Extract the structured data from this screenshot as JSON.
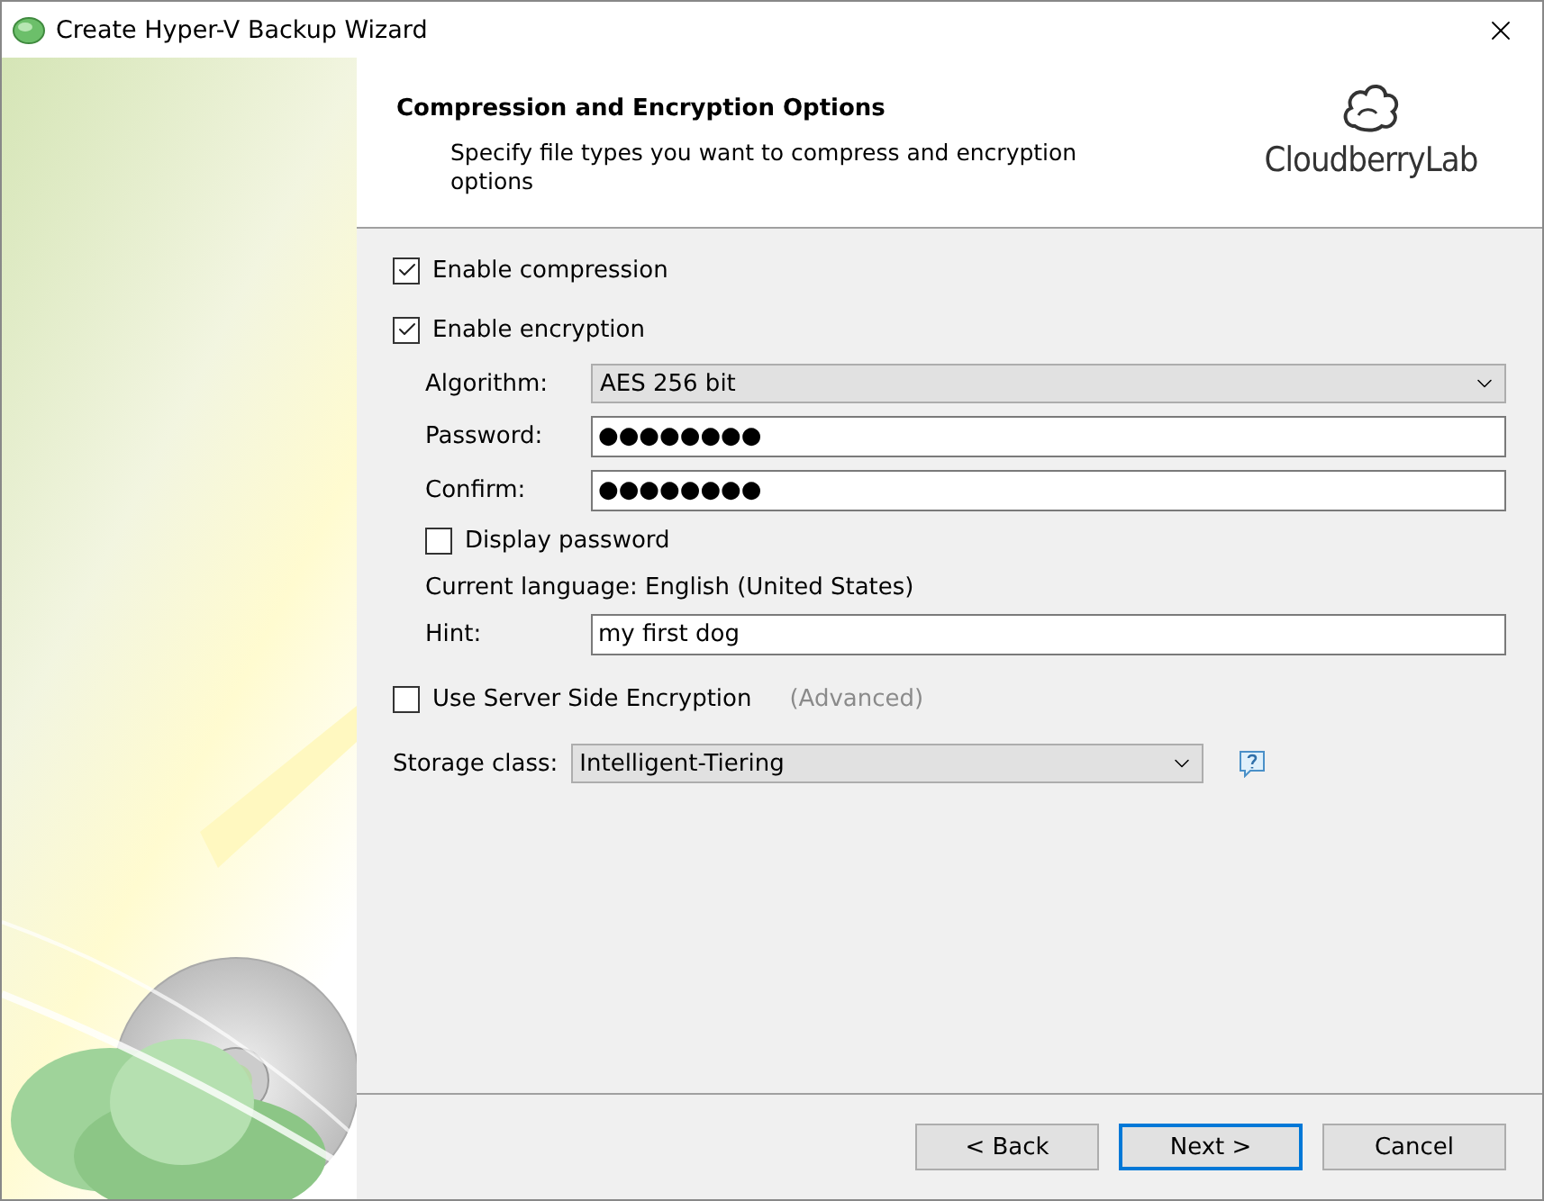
{
  "window": {
    "title": "Create Hyper-V Backup Wizard"
  },
  "header": {
    "title": "Compression and Encryption Options",
    "subtitle": "Specify file types you want to compress and encryption options",
    "logo": "CloudberryLab"
  },
  "compression": {
    "label": "Enable compression",
    "checked": true
  },
  "encryption": {
    "label": "Enable encryption",
    "checked": true
  },
  "algorithm": {
    "label": "Algorithm:",
    "value": "AES 256 bit"
  },
  "password": {
    "label": "Password:",
    "value": "●●●●●●●●"
  },
  "confirm": {
    "label": "Confirm:",
    "value": "●●●●●●●●"
  },
  "display_password": {
    "label": "Display password",
    "checked": false
  },
  "current_language": "Current language: English (United States)",
  "hint": {
    "label": "Hint:",
    "value": "my first dog"
  },
  "server_side_encryption": {
    "label": "Use Server Side Encryption",
    "checked": false,
    "link": "(Advanced)"
  },
  "storage_class": {
    "label": "Storage class:",
    "value": "Intelligent-Tiering"
  },
  "buttons": [
    {
      "label": "< Back",
      "selected": false
    },
    {
      "label": "Next >",
      "selected": true
    },
    {
      "label": "Cancel",
      "selected": false
    }
  ]
}
